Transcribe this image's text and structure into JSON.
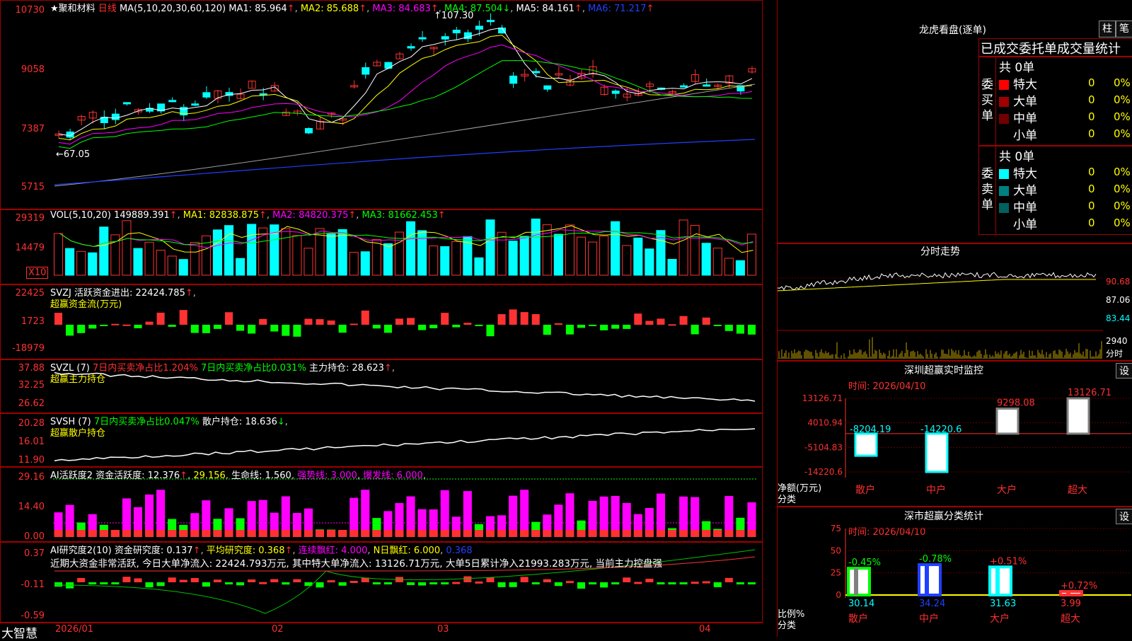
{
  "stock": {
    "name": "★聚和材料",
    "period": "日线"
  },
  "main": {
    "ma_label": "MA(5,10,20,30,60,120)",
    "ma1": "MA1: 85.964",
    "ma2": "MA2: 85.688",
    "ma3": "MA3: 84.683",
    "ma4": "MA4: 87.504",
    "ma5": "MA5: 84.161",
    "ma6": "MA6: 71.217",
    "y_ticks": [
      "10730",
      "9058",
      "7387",
      "5715"
    ],
    "high_label": "107.30",
    "low_label": "67.05"
  },
  "vol": {
    "label": "VOL(5,10,20)",
    "value": "149889.391",
    "ma1": "MA1: 82838.875",
    "ma2": "MA2: 84820.375",
    "ma3": "MA3: 81662.453",
    "y_ticks": [
      "29319",
      "14479"
    ],
    "unit": "X10"
  },
  "svzj": {
    "label": "SVZJ",
    "text1": "活跃资金进出: 22424.785",
    "text2": "超赢资金流(万元)",
    "y_ticks": [
      "22425",
      "1723",
      "-18979"
    ]
  },
  "svzl": {
    "label": "SVZL (7)",
    "t1": "7日内买卖净占比1.204%",
    "t2": "7日内买卖净占比0.031%",
    "t3": "主力持仓: 28.623",
    "t4": "超赢主力持仓",
    "y_ticks": [
      "37.88",
      "32.25",
      "26.62"
    ]
  },
  "svsh": {
    "label": "SVSH (7)",
    "t1": "7日内买卖净占比0.047%",
    "t2": "散户持仓: 18.636",
    "t3": "超赢散户持仓",
    "y_ticks": [
      "20.28",
      "16.01",
      "11.90"
    ]
  },
  "ai1": {
    "label": "AI活跃度2",
    "t1": "资金活跃度: 12.376",
    "t2": "29.156",
    "t3": "生命线: 1.560",
    "t4": "强势线: 3.000",
    "t5": "爆发线: 6.000",
    "y_ticks": [
      "29.16",
      "14.40",
      "0.00"
    ]
  },
  "ai2": {
    "label": "AI研究度2(10)",
    "t1": "资金研究度: 0.137",
    "t2": "平均研究度: 0.368",
    "t3": "连续飘红: 4.000",
    "t4": "N日飘红: 6.000",
    "t5": "0.368",
    "summary": "近期大资金非常活跃, 今日大单净流入: 22424.793万元, 其中特大单净流入: 13126.71万元, 大单5日累计净入21993.283万元, 当前主力控盘强",
    "y_ticks": [
      "0.37",
      "-0.11",
      "-0.59"
    ]
  },
  "xaxis": {
    "labels": [
      "2026/01",
      "02",
      "03",
      "04"
    ],
    "logo": "大智慧"
  },
  "lhb": {
    "title": "龙虎看盘(逐单)",
    "btn1": "柱",
    "btn2": "笔",
    "header": "已成交委托单成交量统计",
    "buy": {
      "side": "委买单",
      "total": "共 0单",
      "rows": [
        {
          "label": "特大",
          "val": "0",
          "pct": "0%",
          "color": "#ff0000"
        },
        {
          "label": "大单",
          "val": "0",
          "pct": "0%",
          "color": "#a00000"
        },
        {
          "label": "中单",
          "val": "0",
          "pct": "0%",
          "color": "#700000"
        },
        {
          "label": "小单",
          "val": "0",
          "pct": "0%",
          "color": "#000000"
        }
      ]
    },
    "sell": {
      "side": "委卖单",
      "total": "共 0单",
      "rows": [
        {
          "label": "特大",
          "val": "0",
          "pct": "0%",
          "color": "#00ffff"
        },
        {
          "label": "大单",
          "val": "0",
          "pct": "0%",
          "color": "#008080"
        },
        {
          "label": "中单",
          "val": "0",
          "pct": "0%",
          "color": "#006060"
        },
        {
          "label": "小单",
          "val": "0",
          "pct": "0%",
          "color": "#000000"
        }
      ]
    }
  },
  "fenshi": {
    "title": "分时走势",
    "y_ticks": [
      "90.68",
      "87.06",
      "83.44"
    ],
    "vol_tick": "2940",
    "vol_unit": "分时"
  },
  "monitor": {
    "title": "深圳超赢实时监控",
    "btn": "设",
    "time": "时间: 2026/04/10",
    "y_ticks": [
      "13126.71",
      "4010.94",
      "-5104.83",
      "-14220.6"
    ],
    "ylabel1": "净额(万元)",
    "ylabel2": "分类",
    "categories": [
      "散户",
      "中户",
      "大户",
      "超大"
    ],
    "bar_labels": [
      "-8204.19",
      "-14220.6",
      "9298.08",
      "13126.71"
    ]
  },
  "classify": {
    "title": "深市超赢分类统计",
    "btn": "设",
    "time": "时间: 2026/04/10",
    "y_ticks": [
      "75",
      "50",
      "25",
      "0"
    ],
    "ylabel1": "比例%",
    "ylabel2": "分类",
    "categories": [
      "散户",
      "中户",
      "大户",
      "超大"
    ],
    "pct_labels": [
      "-0.45%",
      "-0.78%",
      "+0.51%",
      "+0.72%"
    ],
    "bottom_values": [
      "30.14",
      "34.24",
      "31.63",
      "3.99"
    ]
  },
  "chart_data": [
    {
      "type": "bar",
      "title": "深圳超赢实时监控",
      "xlabel": "分类",
      "ylabel": "净额(万元)",
      "categories": [
        "散户",
        "中户",
        "大户",
        "超大"
      ],
      "values": [
        -8204.19,
        -14220.6,
        9298.08,
        13126.71
      ],
      "ylim": [
        -14220.6,
        13126.71
      ]
    },
    {
      "type": "bar",
      "title": "深市超赢分类统计",
      "xlabel": "分类",
      "ylabel": "比例%",
      "categories": [
        "散户",
        "中户",
        "大户",
        "超大"
      ],
      "values": [
        30.14,
        34.24,
        31.63,
        3.99
      ],
      "changes": [
        "-0.45%",
        "-0.78%",
        "+0.51%",
        "+0.72%"
      ],
      "ylim": [
        0,
        75
      ]
    }
  ],
  "colors": {
    "up": "#ff3232",
    "down": "#00ffff",
    "frame": "#a00000",
    "yellow": "#ffff00",
    "magenta": "#ff00ff",
    "green": "#00ff00"
  }
}
